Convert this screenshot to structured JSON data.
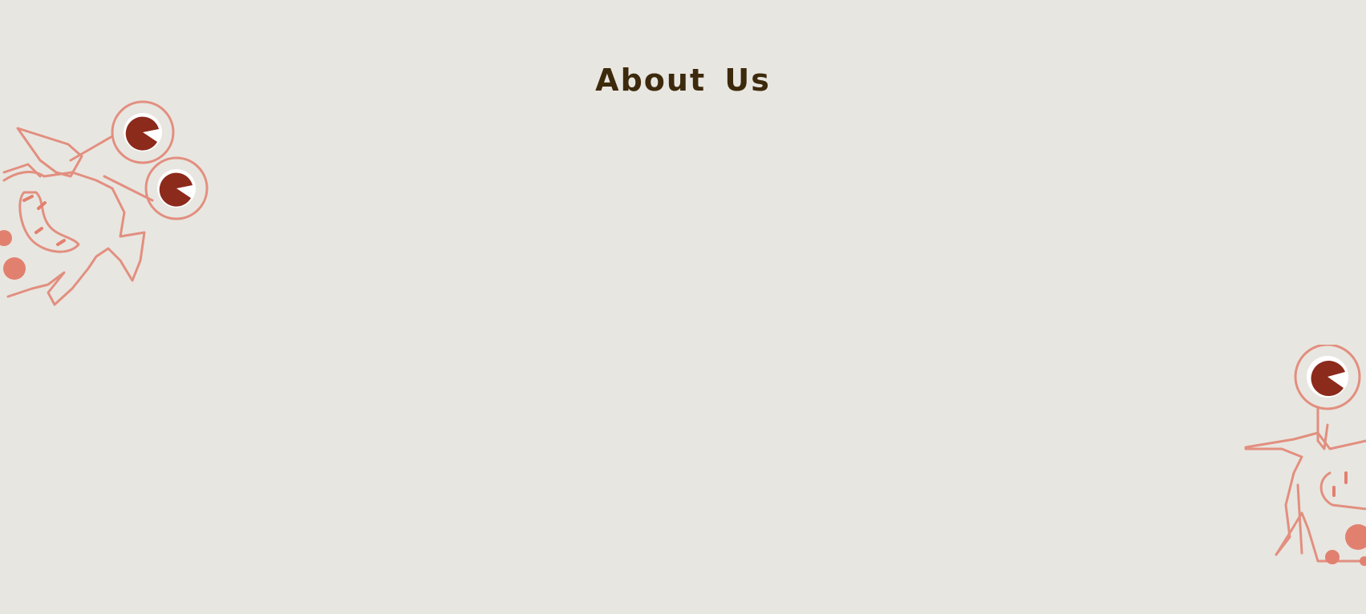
{
  "page": {
    "title": "About Us"
  },
  "decorations": {
    "left_illustration": "two-eyed-monster-illustration",
    "right_illustration": "one-eyed-monster-illustration"
  },
  "colors": {
    "background": "#e8e6e1",
    "title": "#3d2a0c",
    "monster_outline": "#e2806f",
    "eye_pupil": "#8c2a1c"
  }
}
